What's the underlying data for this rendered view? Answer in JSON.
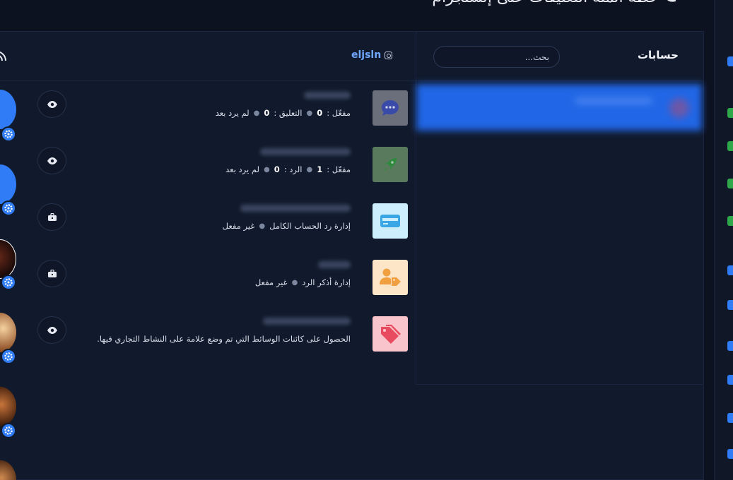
{
  "header": {
    "title": "خطة أتمتة التعليقات على إنستجرام"
  },
  "accounts": {
    "title": "حسابات",
    "search_placeholder": "بحث..."
  },
  "profile": {
    "username": "eljsln"
  },
  "features": [
    {
      "icon": "chat-bubble-icon",
      "icon_bg": "#6b6f7c",
      "icon_color": "#3a4aa8",
      "meta": [
        {
          "label": "مفعّل :",
          "value": "0"
        },
        {
          "label": "التعليق :",
          "value": "0"
        },
        {
          "label": "لم يرد بعد",
          "value": ""
        }
      ],
      "action": "eye-icon"
    },
    {
      "icon": "rocket-icon",
      "icon_bg": "#5a7a5e",
      "icon_color": "#2f8a3d",
      "meta": [
        {
          "label": "مفعّل :",
          "value": "1"
        },
        {
          "label": "الرد :",
          "value": "0"
        },
        {
          "label": "لم يرد بعد",
          "value": ""
        }
      ],
      "action": "eye-icon"
    },
    {
      "icon": "credit-card-icon",
      "icon_bg": "#cdeefd",
      "icon_color": "#3aa6e6",
      "meta": [
        {
          "label": "إدارة رد الحساب الكامل",
          "value": ""
        },
        {
          "label": "غير مفعل",
          "value": ""
        }
      ],
      "action": "toolbox-icon"
    },
    {
      "icon": "user-tag-icon",
      "icon_bg": "#fde6c8",
      "icon_color": "#f0a040",
      "meta": [
        {
          "label": "إدارة أذكر الرد",
          "value": ""
        },
        {
          "label": "غير مفعل",
          "value": ""
        }
      ],
      "action": "toolbox-icon"
    },
    {
      "icon": "tags-icon",
      "icon_bg": "#f9c4cc",
      "icon_color": "#e84a5f",
      "meta": [
        {
          "label": "الحصول على كائنات الوسائط التي تم وضع علامة على النشاط التجاري فيها.",
          "value": ""
        }
      ],
      "action": "eye-icon"
    }
  ],
  "colors": {
    "accent": "#2f7cf6",
    "background": "#0d1220",
    "panel": "#111a2c",
    "selected_account": "#2166e6",
    "username": "#6ea8ff"
  }
}
